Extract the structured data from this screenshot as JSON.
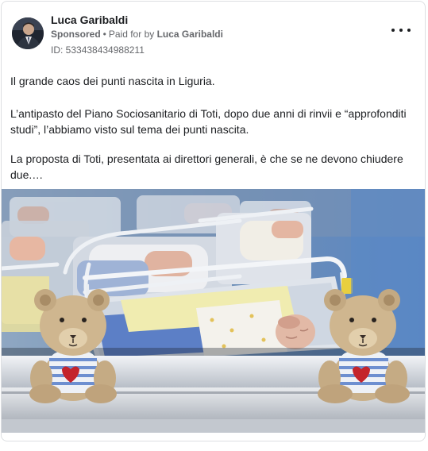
{
  "post": {
    "author": "Luca Garibaldi",
    "sponsored_label": "Sponsored",
    "separator": "•",
    "paid_prefix": "Paid for by",
    "payer": "Luca Garibaldi",
    "ad_id": "ID: 533438434988211",
    "paragraphs": [
      "Il grande caos dei punti nascita in Liguria.",
      "L’antipasto del Piano Sociosanitario di Toti, dopo due anni di rinvii e “approfonditi studi”, l’abbiamo visto sul tema dei punti nascita.",
      "La proposta di Toti, presentata ai direttori generali, è che se ne devono chiudere due.…"
    ],
    "image_subject": "newborns in hospital cribs with two teddy bears in the foreground",
    "icons": {
      "menu": "more-options-icon",
      "avatar": "profile-photo"
    }
  }
}
